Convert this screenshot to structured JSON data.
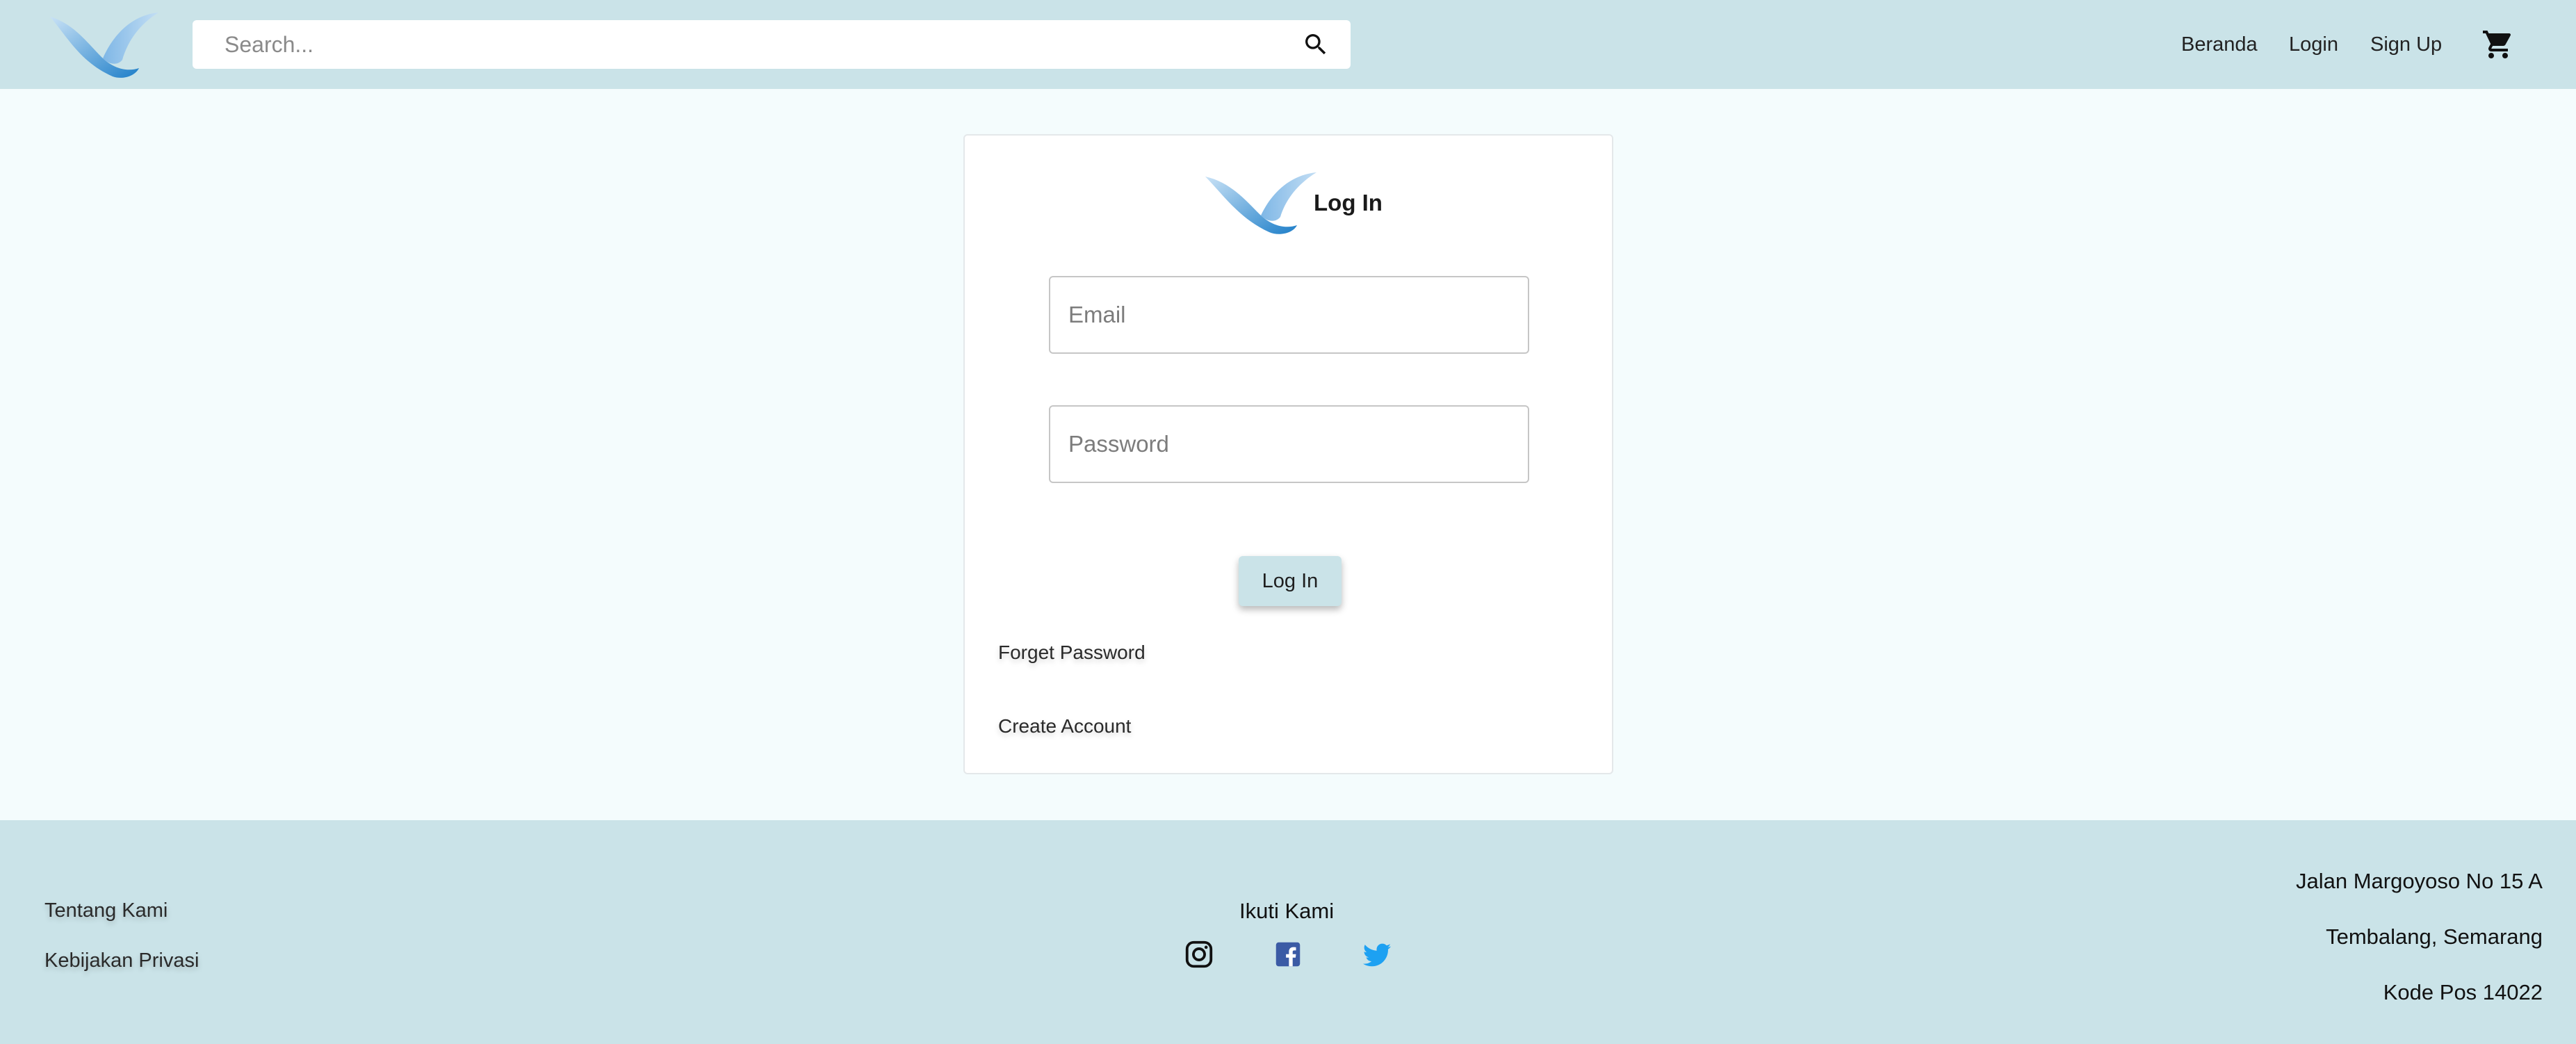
{
  "header": {
    "search_placeholder": "Search...",
    "nav": {
      "home": "Beranda",
      "login": "Login",
      "signup": "Sign Up"
    },
    "icons": [
      "bird-logo-icon",
      "search-icon",
      "cart-icon"
    ]
  },
  "login_card": {
    "title": "Log In",
    "email_placeholder": "Email",
    "password_placeholder": "Password",
    "submit_label": "Log In",
    "forgot_password": "Forget Password",
    "create_account": "Create Account"
  },
  "footer": {
    "links": {
      "about": "Tentang Kami",
      "privacy": "Kebijakan Privasi"
    },
    "follow_title": "Ikuti Kami",
    "social": [
      "instagram-icon",
      "facebook-icon",
      "twitter-icon"
    ],
    "address": {
      "line1": "Jalan Margoyoso No 15 A",
      "line2": "Tembalang, Semarang",
      "line3": "Kode Pos 14022"
    }
  },
  "colors": {
    "header_bg": "#cae3e8",
    "page_bg": "#f4fcfd",
    "logo_dark": "#1f7fc9",
    "logo_light": "#a9d3f2",
    "facebook": "#3b5ba5",
    "twitter": "#1da1f2"
  }
}
